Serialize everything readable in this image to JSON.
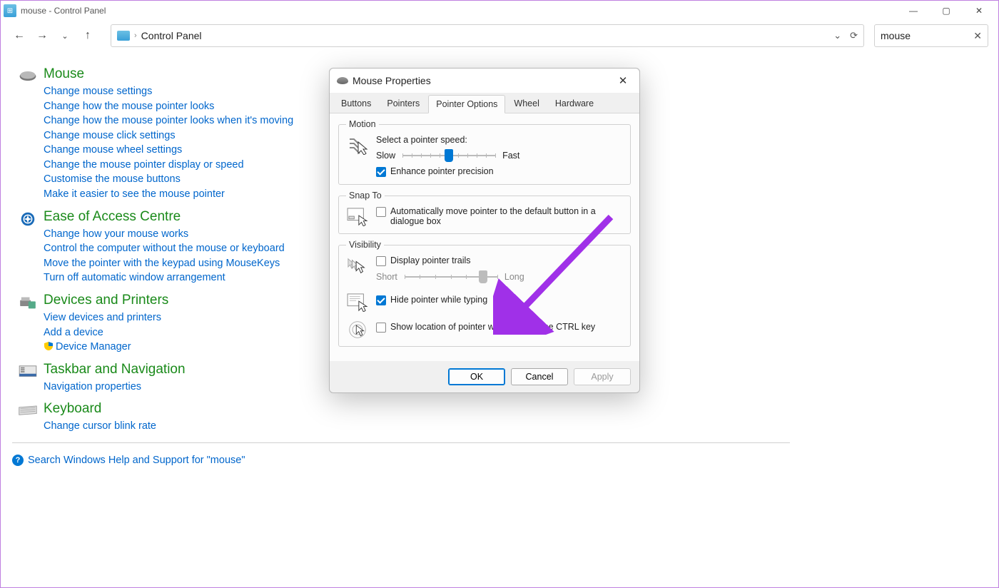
{
  "window": {
    "title": "mouse - Control Panel",
    "breadcrumb": "Control Panel",
    "search_value": "mouse"
  },
  "groups": [
    {
      "title": "Mouse",
      "links": [
        "Change mouse settings",
        "Change how the mouse pointer looks",
        "Change how the mouse pointer looks when it's moving",
        "Change mouse click settings",
        "Change mouse wheel settings",
        "Change the mouse pointer display or speed",
        "Customise the mouse buttons",
        "Make it easier to see the mouse pointer"
      ]
    },
    {
      "title": "Ease of Access Centre",
      "links": [
        "Change how your mouse works",
        "Control the computer without the mouse or keyboard",
        "Move the pointer with the keypad using MouseKeys",
        "Turn off automatic window arrangement"
      ]
    },
    {
      "title": "Devices and Printers",
      "links": [
        "View devices and printers",
        "Add a device",
        "Device Manager"
      ]
    },
    {
      "title": "Taskbar and Navigation",
      "links": [
        "Navigation properties"
      ]
    },
    {
      "title": "Keyboard",
      "links": [
        "Change cursor blink rate"
      ]
    }
  ],
  "help_link": "Search Windows Help and Support for \"mouse\"",
  "dialog": {
    "title": "Mouse Properties",
    "tabs": [
      "Buttons",
      "Pointers",
      "Pointer Options",
      "Wheel",
      "Hardware"
    ],
    "active_tab": 2,
    "motion": {
      "legend": "Motion",
      "label": "Select a pointer speed:",
      "slow": "Slow",
      "fast": "Fast",
      "enhance": "Enhance pointer precision",
      "enhance_checked": true,
      "speed_pos": 0.5
    },
    "snap": {
      "legend": "Snap To",
      "label": "Automatically move pointer to the default button in a dialogue box",
      "checked": false
    },
    "visibility": {
      "legend": "Visibility",
      "trails": "Display pointer trails",
      "trails_checked": false,
      "short": "Short",
      "long": "Long",
      "trail_pos": 0.85,
      "hide": "Hide pointer while typing",
      "hide_checked": true,
      "ctrl": "Show location of pointer when I press the CTRL key",
      "ctrl_checked": false
    },
    "buttons": {
      "ok": "OK",
      "cancel": "Cancel",
      "apply": "Apply"
    }
  }
}
